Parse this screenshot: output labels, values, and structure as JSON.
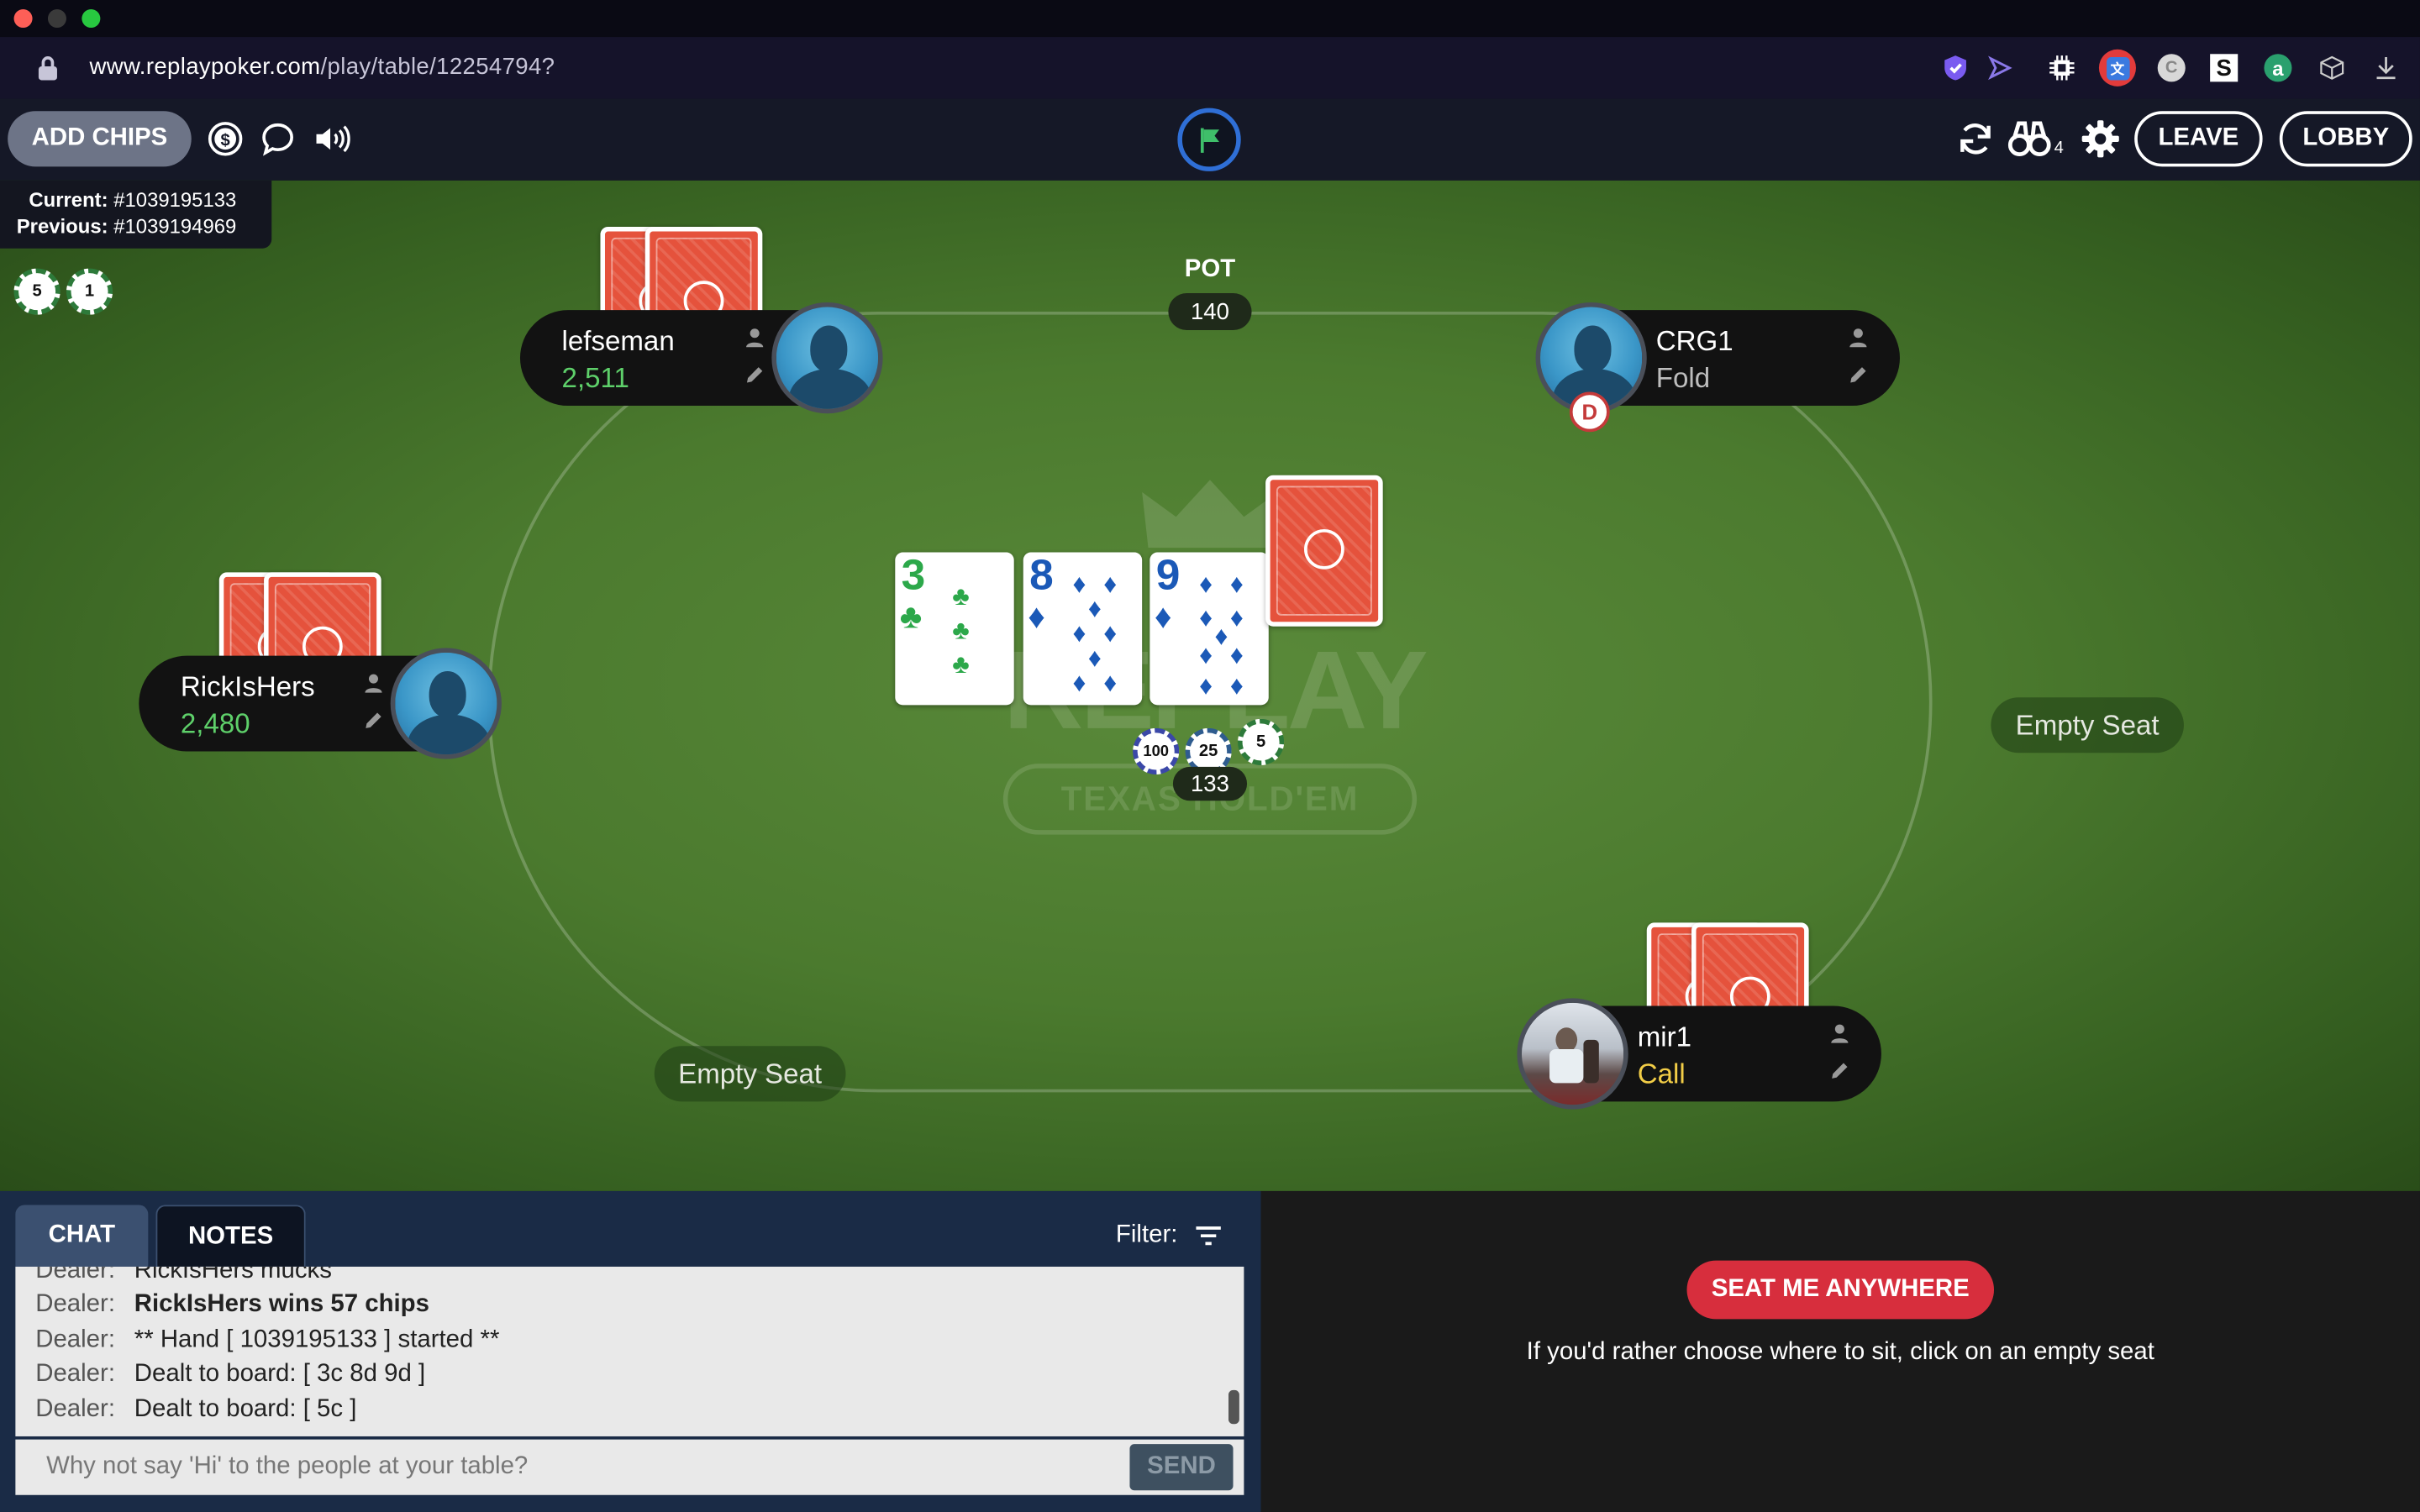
{
  "browser": {
    "url_host": "www.replaypoker.com",
    "url_path": "/play/table/12254794?",
    "extensions": [
      "shield-check-icon",
      "play-arrow-icon",
      "chip-icon",
      "translate-icon",
      "circle-icon",
      "s-icon",
      "a-icon",
      "cube-icon",
      "download-icon"
    ]
  },
  "toolbar": {
    "add_chips_label": "ADD CHIPS",
    "leave_label": "LEAVE",
    "lobby_label": "LOBBY",
    "observers_count": "4"
  },
  "hand_info": {
    "current_label": "Current:",
    "current_value": "#1039195133",
    "previous_label": "Previous:",
    "previous_value": "#1039194969"
  },
  "rake_chips": [
    "5",
    "1"
  ],
  "pot": {
    "label": "POT",
    "amount": "140"
  },
  "bet": {
    "chips": [
      "100",
      "25",
      "5"
    ],
    "amount": "133"
  },
  "board": [
    {
      "rank": "3",
      "suit": "clubs",
      "symbol": "♣",
      "color": "#2ca84a"
    },
    {
      "rank": "8",
      "suit": "diamonds",
      "symbol": "♦",
      "color": "#1b59b7"
    },
    {
      "rank": "9",
      "suit": "diamonds",
      "symbol": "♦",
      "color": "#1b59b7"
    }
  ],
  "players": {
    "lefseman": {
      "name": "lefseman",
      "stack": "2,511",
      "stack_color": "#5ed06a"
    },
    "crg1": {
      "name": "CRG1",
      "status": "Fold",
      "status_color": "#bdbdbd"
    },
    "ricklshers": {
      "name": "RickIsHers",
      "stack": "2,480",
      "stack_color": "#5ed06a"
    },
    "mir1": {
      "name": "mir1",
      "status": "Call",
      "status_color": "#f2cd47"
    }
  },
  "dealer_button": "D",
  "empty_seats": {
    "right": "Empty Seat",
    "bottom_left": "Empty Seat"
  },
  "chat": {
    "tabs": [
      "CHAT",
      "NOTES"
    ],
    "filter_label": "Filter:",
    "lines": [
      {
        "who": "Dealer:",
        "text": "RickIsHers mucks",
        "bold": false
      },
      {
        "who": "Dealer:",
        "text": "RickIsHers wins 57 chips",
        "bold": true
      },
      {
        "who": "Dealer:",
        "text": "** Hand [ 1039195133 ] started **",
        "bold": false
      },
      {
        "who": "Dealer:",
        "text": "Dealt to board: [ 3c 8d 9d ]",
        "bold": false
      },
      {
        "who": "Dealer:",
        "text": "Dealt to board: [ 5c ]",
        "bold": false
      }
    ],
    "input_placeholder": "Why not say 'Hi' to the people at your table?",
    "send_label": "SEND"
  },
  "seat_panel": {
    "seat_me_label": "SEAT ME ANYWHERE",
    "hint": "If you'd rather choose where to sit, click on an empty seat"
  },
  "colors": {
    "felt": "#4b7a2e",
    "accent_red": "#d72e3d",
    "card_back": "#e5523c"
  }
}
